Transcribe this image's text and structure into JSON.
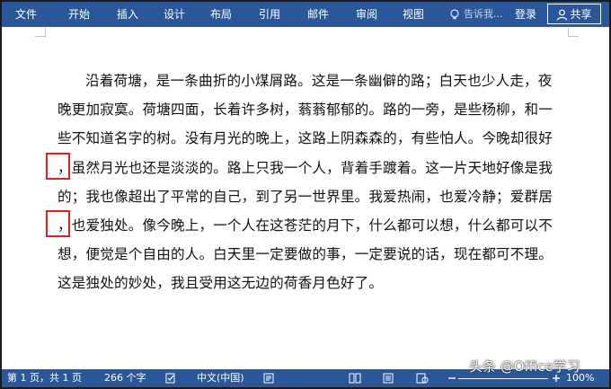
{
  "ribbon": {
    "file": "文件",
    "tabs": [
      "开始",
      "插入",
      "设计",
      "布局",
      "引用",
      "邮件",
      "审阅",
      "视图"
    ],
    "tell_me": "告诉我...",
    "login": "登录",
    "share": "共享"
  },
  "document": {
    "lines": [
      "沿着荷塘，是一条曲折的小煤屑路。这是一条幽僻的路；白天也少人走，夜",
      "晚更加寂寞。荷塘四面，长着许多树，蓊蓊郁郁的。路的一旁，是些杨柳，和一",
      "些不知道名字的树。没有月光的晚上，这路上阴森森的，有些怕人。今晚却很好",
      "，虽然月光也还是淡淡的。路上只我一个人，背着手踱着。这一片天地好像是我",
      "的；我也像超出了平常的自己，到了另一世界里。我爱热闹，也爱冷静；爱群居",
      "，也爱独处。像今晚上，一个人在这苍茫的月下，什么都可以想，什么都可以不",
      "想，便觉是个自由的人。白天里一定要做的事，一定要说的话，现在都可不理。",
      "这是独处的妙处，我且受用这无边的荷香月色好了。"
    ]
  },
  "statusbar": {
    "page": "第 1 页，共 1 页",
    "words": "266 个字",
    "language": "中文(中国)",
    "zoom": "100%"
  },
  "watermark": "头条 @Office学习"
}
